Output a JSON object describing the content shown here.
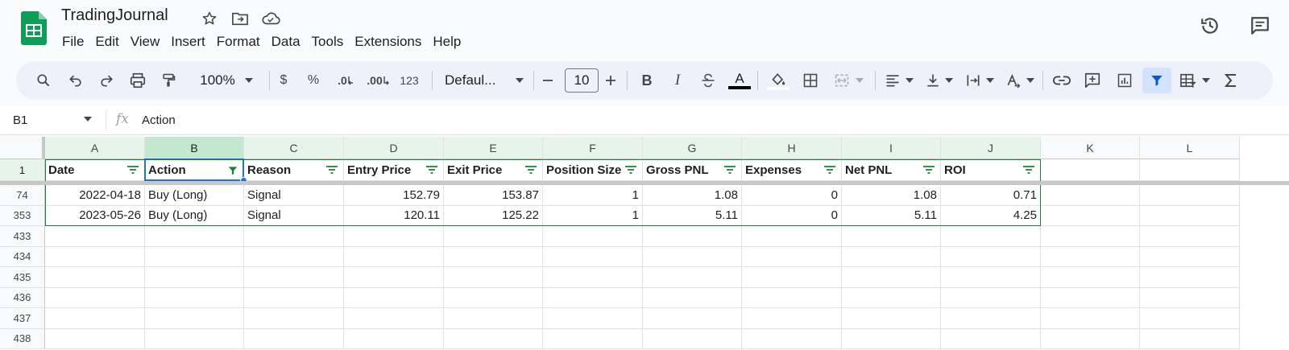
{
  "app": {
    "title": "TradingJournal",
    "menu": [
      "File",
      "Edit",
      "View",
      "Insert",
      "Format",
      "Data",
      "Tools",
      "Extensions",
      "Help"
    ]
  },
  "toolbar": {
    "zoom": "100%",
    "currency": "$",
    "percent": "%",
    "decrease_decimal": ".0",
    "increase_decimal": ".00",
    "number_format": "123",
    "font": "Defaul...",
    "font_size": "10",
    "bold": "B",
    "italic": "I",
    "text_color": "A"
  },
  "formula_bar": {
    "cell_ref": "B1",
    "fx": "fx",
    "content": "Action"
  },
  "grid": {
    "columns": [
      "A",
      "B",
      "C",
      "D",
      "E",
      "F",
      "G",
      "H",
      "I",
      "J",
      "K",
      "L"
    ],
    "headers": [
      "Date",
      "Action",
      "Reason",
      "Entry Price",
      "Exit Price",
      "Position Size",
      "Gross PNL",
      "Expenses",
      "Net PNL",
      "ROI"
    ],
    "header_row_number": "1",
    "rows": [
      {
        "row": "74",
        "cells": [
          "2022-04-18",
          "Buy (Long)",
          "Signal",
          "152.79",
          "153.87",
          "1",
          "1.08",
          "0",
          "1.08",
          "0.71"
        ]
      },
      {
        "row": "353",
        "cells": [
          "2023-05-26",
          "Buy (Long)",
          "Signal",
          "120.11",
          "125.22",
          "1",
          "5.11",
          "0",
          "5.11",
          "4.25"
        ]
      }
    ],
    "empty_rows": [
      "433",
      "434",
      "435",
      "436",
      "437",
      "438"
    ]
  },
  "colors": {
    "accent_green": "#188038",
    "selection_blue": "#1a73e8",
    "toolbar_bg": "#edf2fa",
    "sheets_logo": "#0f9d58"
  }
}
